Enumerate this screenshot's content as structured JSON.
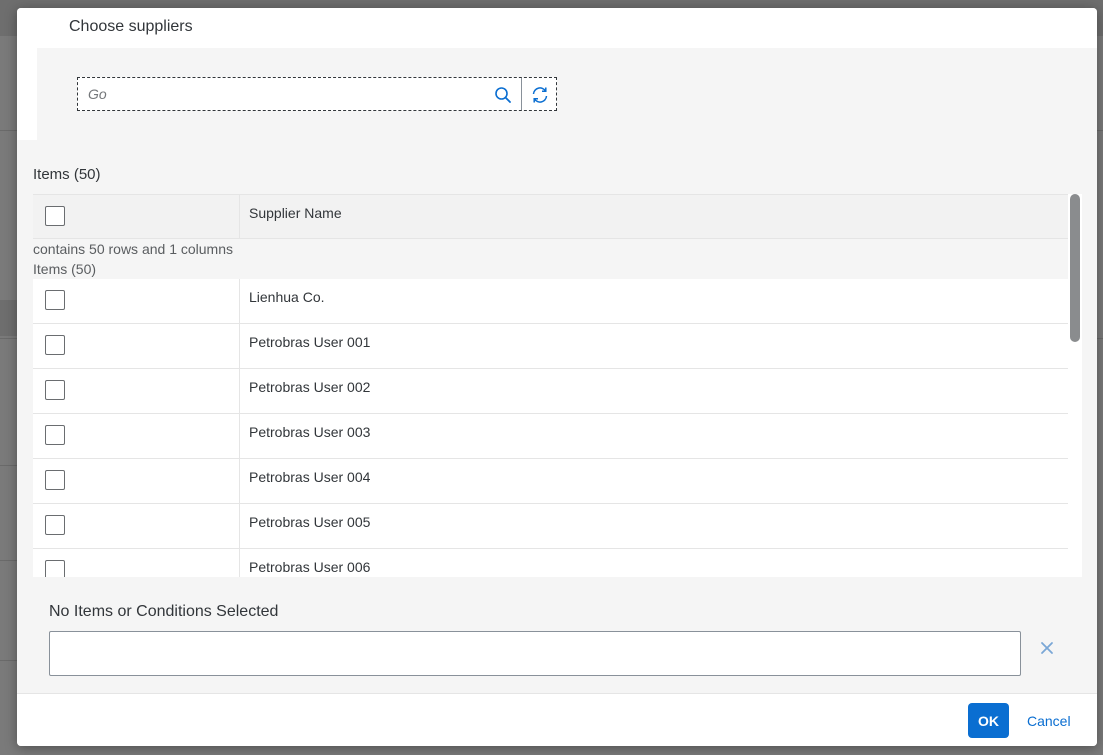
{
  "dialog": {
    "title": "Choose suppliers"
  },
  "search": {
    "placeholder": "Go",
    "value": ""
  },
  "table": {
    "title": "Items (50)",
    "header_label": "Supplier Name",
    "sr_info": "contains 50 rows and 1 columns",
    "sr_title": "Items (50)",
    "rows": [
      "Lienhua Co.",
      "Petrobras User 001",
      "Petrobras User 002",
      "Petrobras User 003",
      "Petrobras User 004",
      "Petrobras User 005",
      "Petrobras User 006"
    ]
  },
  "selection": {
    "title": "No Items or Conditions Selected"
  },
  "footer": {
    "ok_label": "OK",
    "cancel_label": "Cancel"
  },
  "colors": {
    "accent": "#0a6ed1",
    "text": "#32363a",
    "overlay": "#7a7a7a"
  }
}
